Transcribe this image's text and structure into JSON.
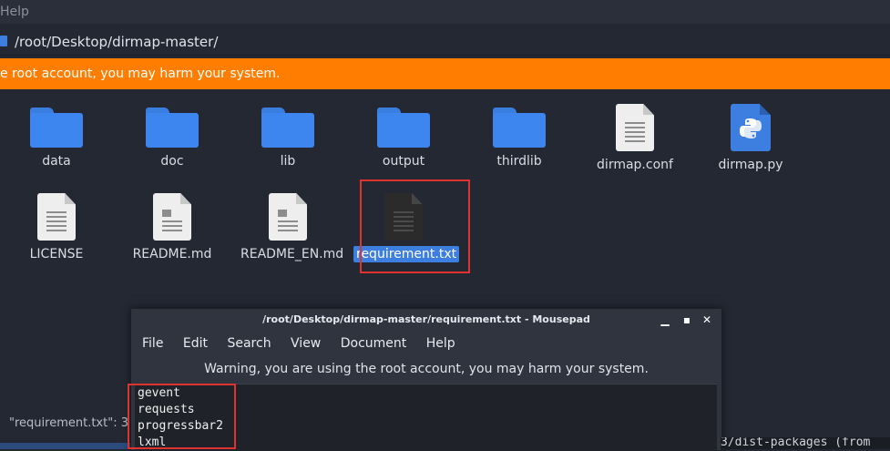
{
  "menubar": {
    "help_label": "Help"
  },
  "pathbar": {
    "path": "/root/Desktop/dirmap-master/"
  },
  "warning_bar": {
    "text": "e root account, you may harm your system."
  },
  "files": [
    {
      "name": "data",
      "type": "folder-icon"
    },
    {
      "name": "doc",
      "type": "folder-icon"
    },
    {
      "name": "lib",
      "type": "folder-icon"
    },
    {
      "name": "output",
      "type": "folder-icon"
    },
    {
      "name": "thirdlib",
      "type": "folder-icon"
    },
    {
      "name": "dirmap.conf",
      "type": "text-file-icon"
    },
    {
      "name": "dirmap.py",
      "type": "python-file-icon"
    },
    {
      "name": "LICENSE",
      "type": "text-file-icon"
    },
    {
      "name": "README.md",
      "type": "markdown-file-icon"
    },
    {
      "name": "README_EN.md",
      "type": "markdown-file-icon"
    },
    {
      "name": "requirement.txt",
      "type": "text-file-icon",
      "selected": true
    }
  ],
  "mousepad": {
    "title": "/root/Desktop/dirmap-master/requirement.txt - Mousepad",
    "menu": [
      "File",
      "Edit",
      "Search",
      "View",
      "Document",
      "Help"
    ],
    "warning": "Warning, you are using the root account, you may harm your system.",
    "lines": [
      "gevent",
      "requests",
      "progressbar2",
      "lxml"
    ]
  },
  "statusbar": {
    "text": "\"requirement.txt\": 3"
  },
  "terminal_fragment": {
    "text": "3/dist-packages (from"
  },
  "colors": {
    "accent": "#3d7fe0",
    "warning": "#ff7d00",
    "highlight_box": "#e0322f"
  }
}
